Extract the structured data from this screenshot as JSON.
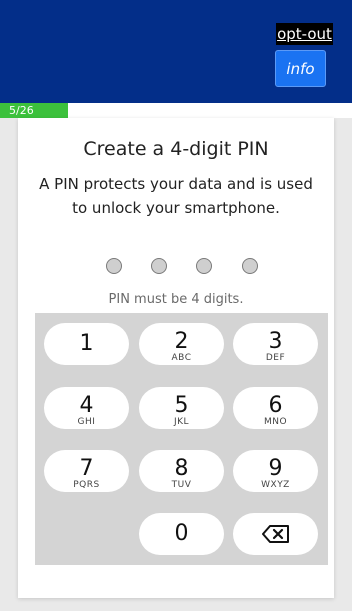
{
  "header": {
    "optout_label": "opt-out",
    "info_label": "info"
  },
  "progress": {
    "label": "5/26",
    "fraction": 0.1923,
    "color": "#3cc13c"
  },
  "pin": {
    "title": "Create a 4-digit PIN",
    "description": "A PIN protects your data and is used to unlock your smartphone.",
    "dots_total": 4,
    "dots_filled": 0,
    "error": "PIN must be 4 digits."
  },
  "keypad": {
    "keys": [
      {
        "digit": "1",
        "letters": ""
      },
      {
        "digit": "2",
        "letters": "ABC"
      },
      {
        "digit": "3",
        "letters": "DEF"
      },
      {
        "digit": "4",
        "letters": "GHI"
      },
      {
        "digit": "5",
        "letters": "JKL"
      },
      {
        "digit": "6",
        "letters": "MNO"
      },
      {
        "digit": "7",
        "letters": "PQRS"
      },
      {
        "digit": "8",
        "letters": "TUV"
      },
      {
        "digit": "9",
        "letters": "WXYZ"
      },
      {
        "digit": "0",
        "letters": ""
      }
    ],
    "backspace_icon": "backspace-icon"
  },
  "colors": {
    "header_bg": "#032e89",
    "info_bg": "#1a73f2",
    "keypad_bg": "#d4d4d4"
  }
}
